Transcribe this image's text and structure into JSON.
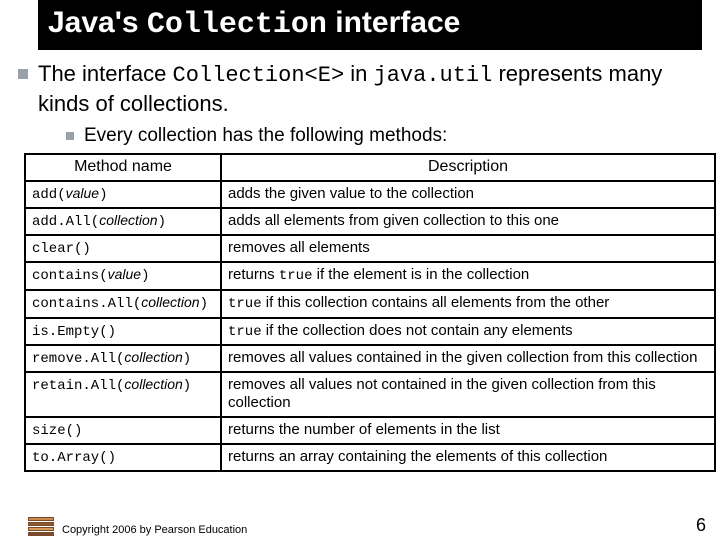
{
  "title": {
    "pre": "Java's ",
    "mono": "Collection",
    "post": " interface"
  },
  "bullet": {
    "pre": "The interface ",
    "mono1": "Collection<E>",
    "mid": " in ",
    "mono2": "java.util",
    "post": " represents many kinds of collections."
  },
  "subbullet": "Every collection has the following methods:",
  "table": {
    "head_method": "Method name",
    "head_desc": "Description",
    "rows": [
      {
        "m_pre": "add(",
        "m_param": "value",
        "m_post": ")",
        "d_mono": "",
        "d_text": "adds the given value to the collection"
      },
      {
        "m_pre": "add.All(",
        "m_param": "collection",
        "m_post": ")",
        "d_mono": "",
        "d_text": "adds all elements from given collection to this one"
      },
      {
        "m_pre": "clear()",
        "m_param": "",
        "m_post": "",
        "d_mono": "",
        "d_text": "removes all elements"
      },
      {
        "m_pre": "contains(",
        "m_param": "value",
        "m_post": ")",
        "d_mono": "true",
        "d_text": " if the element is in the collection",
        "d_pre": "returns "
      },
      {
        "m_pre": "contains.All(",
        "m_param": "collection",
        "m_post": ")",
        "d_mono": "true",
        "d_text": " if this collection contains all elements from the other"
      },
      {
        "m_pre": "is.Empty()",
        "m_param": "",
        "m_post": "",
        "d_mono": "true",
        "d_text": " if the collection does not contain any elements"
      },
      {
        "m_pre": "remove.All(",
        "m_param": "collection",
        "m_post": ")",
        "d_mono": "",
        "d_text": "removes all values contained in the given collection from this collection"
      },
      {
        "m_pre": "retain.All(",
        "m_param": "collection",
        "m_post": ")",
        "d_mono": "",
        "d_text": "removes all values not contained in the given collection from this collection"
      },
      {
        "m_pre": "size()",
        "m_param": "",
        "m_post": "",
        "d_mono": "",
        "d_text": "returns the number of elements in the list"
      },
      {
        "m_pre": "to.Array()",
        "m_param": "",
        "m_post": "",
        "d_mono": "",
        "d_text": "returns an array containing the elements of this collection"
      }
    ]
  },
  "footer": {
    "copyright": "Copyright 2006 by Pearson Education",
    "page": "6"
  }
}
